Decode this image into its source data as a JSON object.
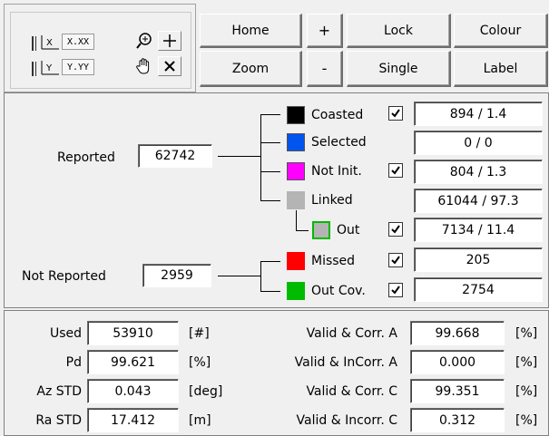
{
  "toolbar": {
    "home": "Home",
    "plus": "+",
    "lock": "Lock",
    "colour": "Colour",
    "zoom": "Zoom",
    "minus": "-",
    "single": "Single",
    "label": "Label",
    "axis_x_text": "X.XX",
    "axis_y_text": "Y.YY"
  },
  "tracks": {
    "reported_label": "Reported",
    "reported_value": "62742",
    "not_reported_label": "Not Reported",
    "not_reported_value": "2959",
    "categories": [
      {
        "label": "Coasted",
        "color": "#000000",
        "checked": true,
        "value": "894 / 1.4"
      },
      {
        "label": "Selected",
        "color": "#0055ee",
        "checked": false,
        "value": "0 / 0"
      },
      {
        "label": "Not Init.",
        "color": "#ff00ff",
        "checked": true,
        "value": "804 / 1.3"
      },
      {
        "label": "Linked",
        "color": "#b4b4b4",
        "checked": false,
        "value": "61044 / 97.3"
      },
      {
        "label": "Out",
        "color": "#b4b4b4",
        "checked": true,
        "value": "7134 / 11.4"
      },
      {
        "label": "Missed",
        "color": "#ff0000",
        "checked": true,
        "value": "205"
      },
      {
        "label": "Out Cov.",
        "color": "#00bb00",
        "checked": true,
        "value": "2754"
      }
    ]
  },
  "stats": {
    "left": [
      {
        "label": "Used",
        "value": "53910",
        "unit": "[#]"
      },
      {
        "label": "Pd",
        "value": "99.621",
        "unit": "[%]"
      },
      {
        "label": "Az STD",
        "value": "0.043",
        "unit": "[deg]"
      },
      {
        "label": "Ra STD",
        "value": "17.412",
        "unit": "[m]"
      }
    ],
    "right": [
      {
        "label": "Valid & Corr. A",
        "value": "99.668",
        "unit": "[%]"
      },
      {
        "label": "Valid & InCorr. A",
        "value": "0.000",
        "unit": "[%]"
      },
      {
        "label": "Valid & Corr. C",
        "value": "99.351",
        "unit": "[%]"
      },
      {
        "label": "Valid & Incorr. C",
        "value": "0.312",
        "unit": "[%]"
      }
    ]
  }
}
